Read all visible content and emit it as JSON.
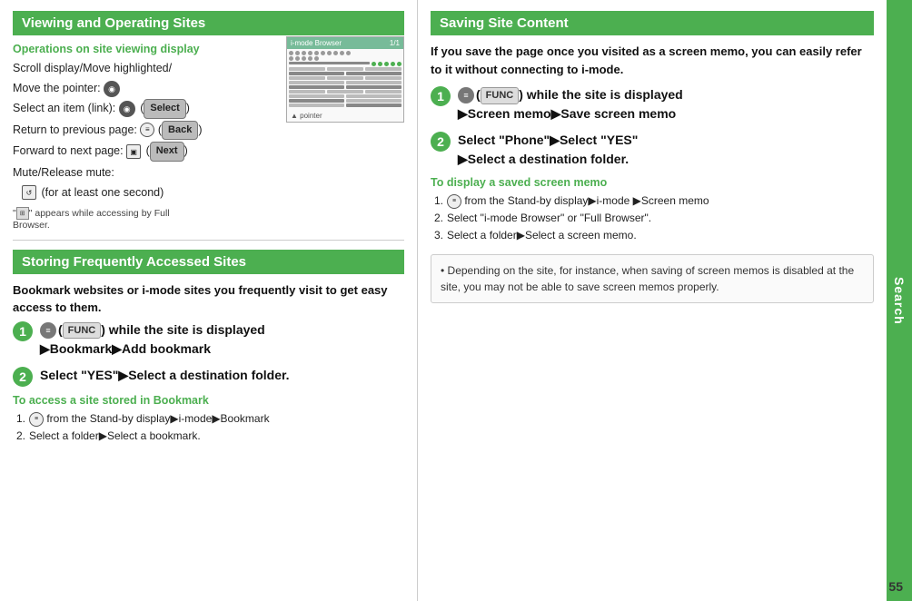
{
  "left": {
    "header": "Viewing and Operating Sites",
    "subsection_title": "Operations on site viewing display",
    "items": [
      "Scroll display/Move highlighted/",
      "Move the pointer:",
      "Select an item (link):",
      "Return to previous page:",
      "Forward to next page:",
      "Mute/Release mute:",
      "(for at least one second)"
    ],
    "select_label": "Select",
    "back_label": "Back",
    "next_label": "Next",
    "browser_header_left": "i-mode Browser",
    "browser_header_right": "1/1",
    "pointer_note_left": "\"",
    "pointer_note_icon": "📶",
    "pointer_note_right": "\" appears while accessing by Full Browser.",
    "pointer_label": "Pointer",
    "section2_header": "Storing Frequently Accessed Sites",
    "section2_intro": "Bookmark websites or i-mode sites you frequently visit to get easy access to them.",
    "step1_text": "( FUNC ) while the site is displayed ▶Bookmark▶Add bookmark",
    "step2_text": "Select \"YES\"▶Select a destination folder.",
    "access_title": "To access a site stored in Bookmark",
    "access_items": [
      "from the Stand-by display▶i-mode▶Bookmark",
      "Select a folder▶Select a bookmark."
    ]
  },
  "right": {
    "header": "Saving Site Content",
    "intro": "If you save the page once you visited as a screen memo, you can easily refer to it without connecting to i-mode.",
    "step1_text": "( FUNC ) while the site is displayed ▶Screen memo▶Save screen memo",
    "step2_text": "Select \"Phone\"▶Select \"YES\" ▶Select a destination folder.",
    "display_title": "To display a saved screen memo",
    "display_items": [
      "from the Stand-by display▶i-mode ▶Screen memo",
      "Select \"i-mode Browser\" or \"Full Browser\".",
      "Select a folder▶Select a screen memo."
    ],
    "note": "Depending on the site, for instance, when saving of screen memos is disabled at the site, you may not be able to save screen memos properly."
  },
  "page_number": "55",
  "sidebar_label": "Search"
}
